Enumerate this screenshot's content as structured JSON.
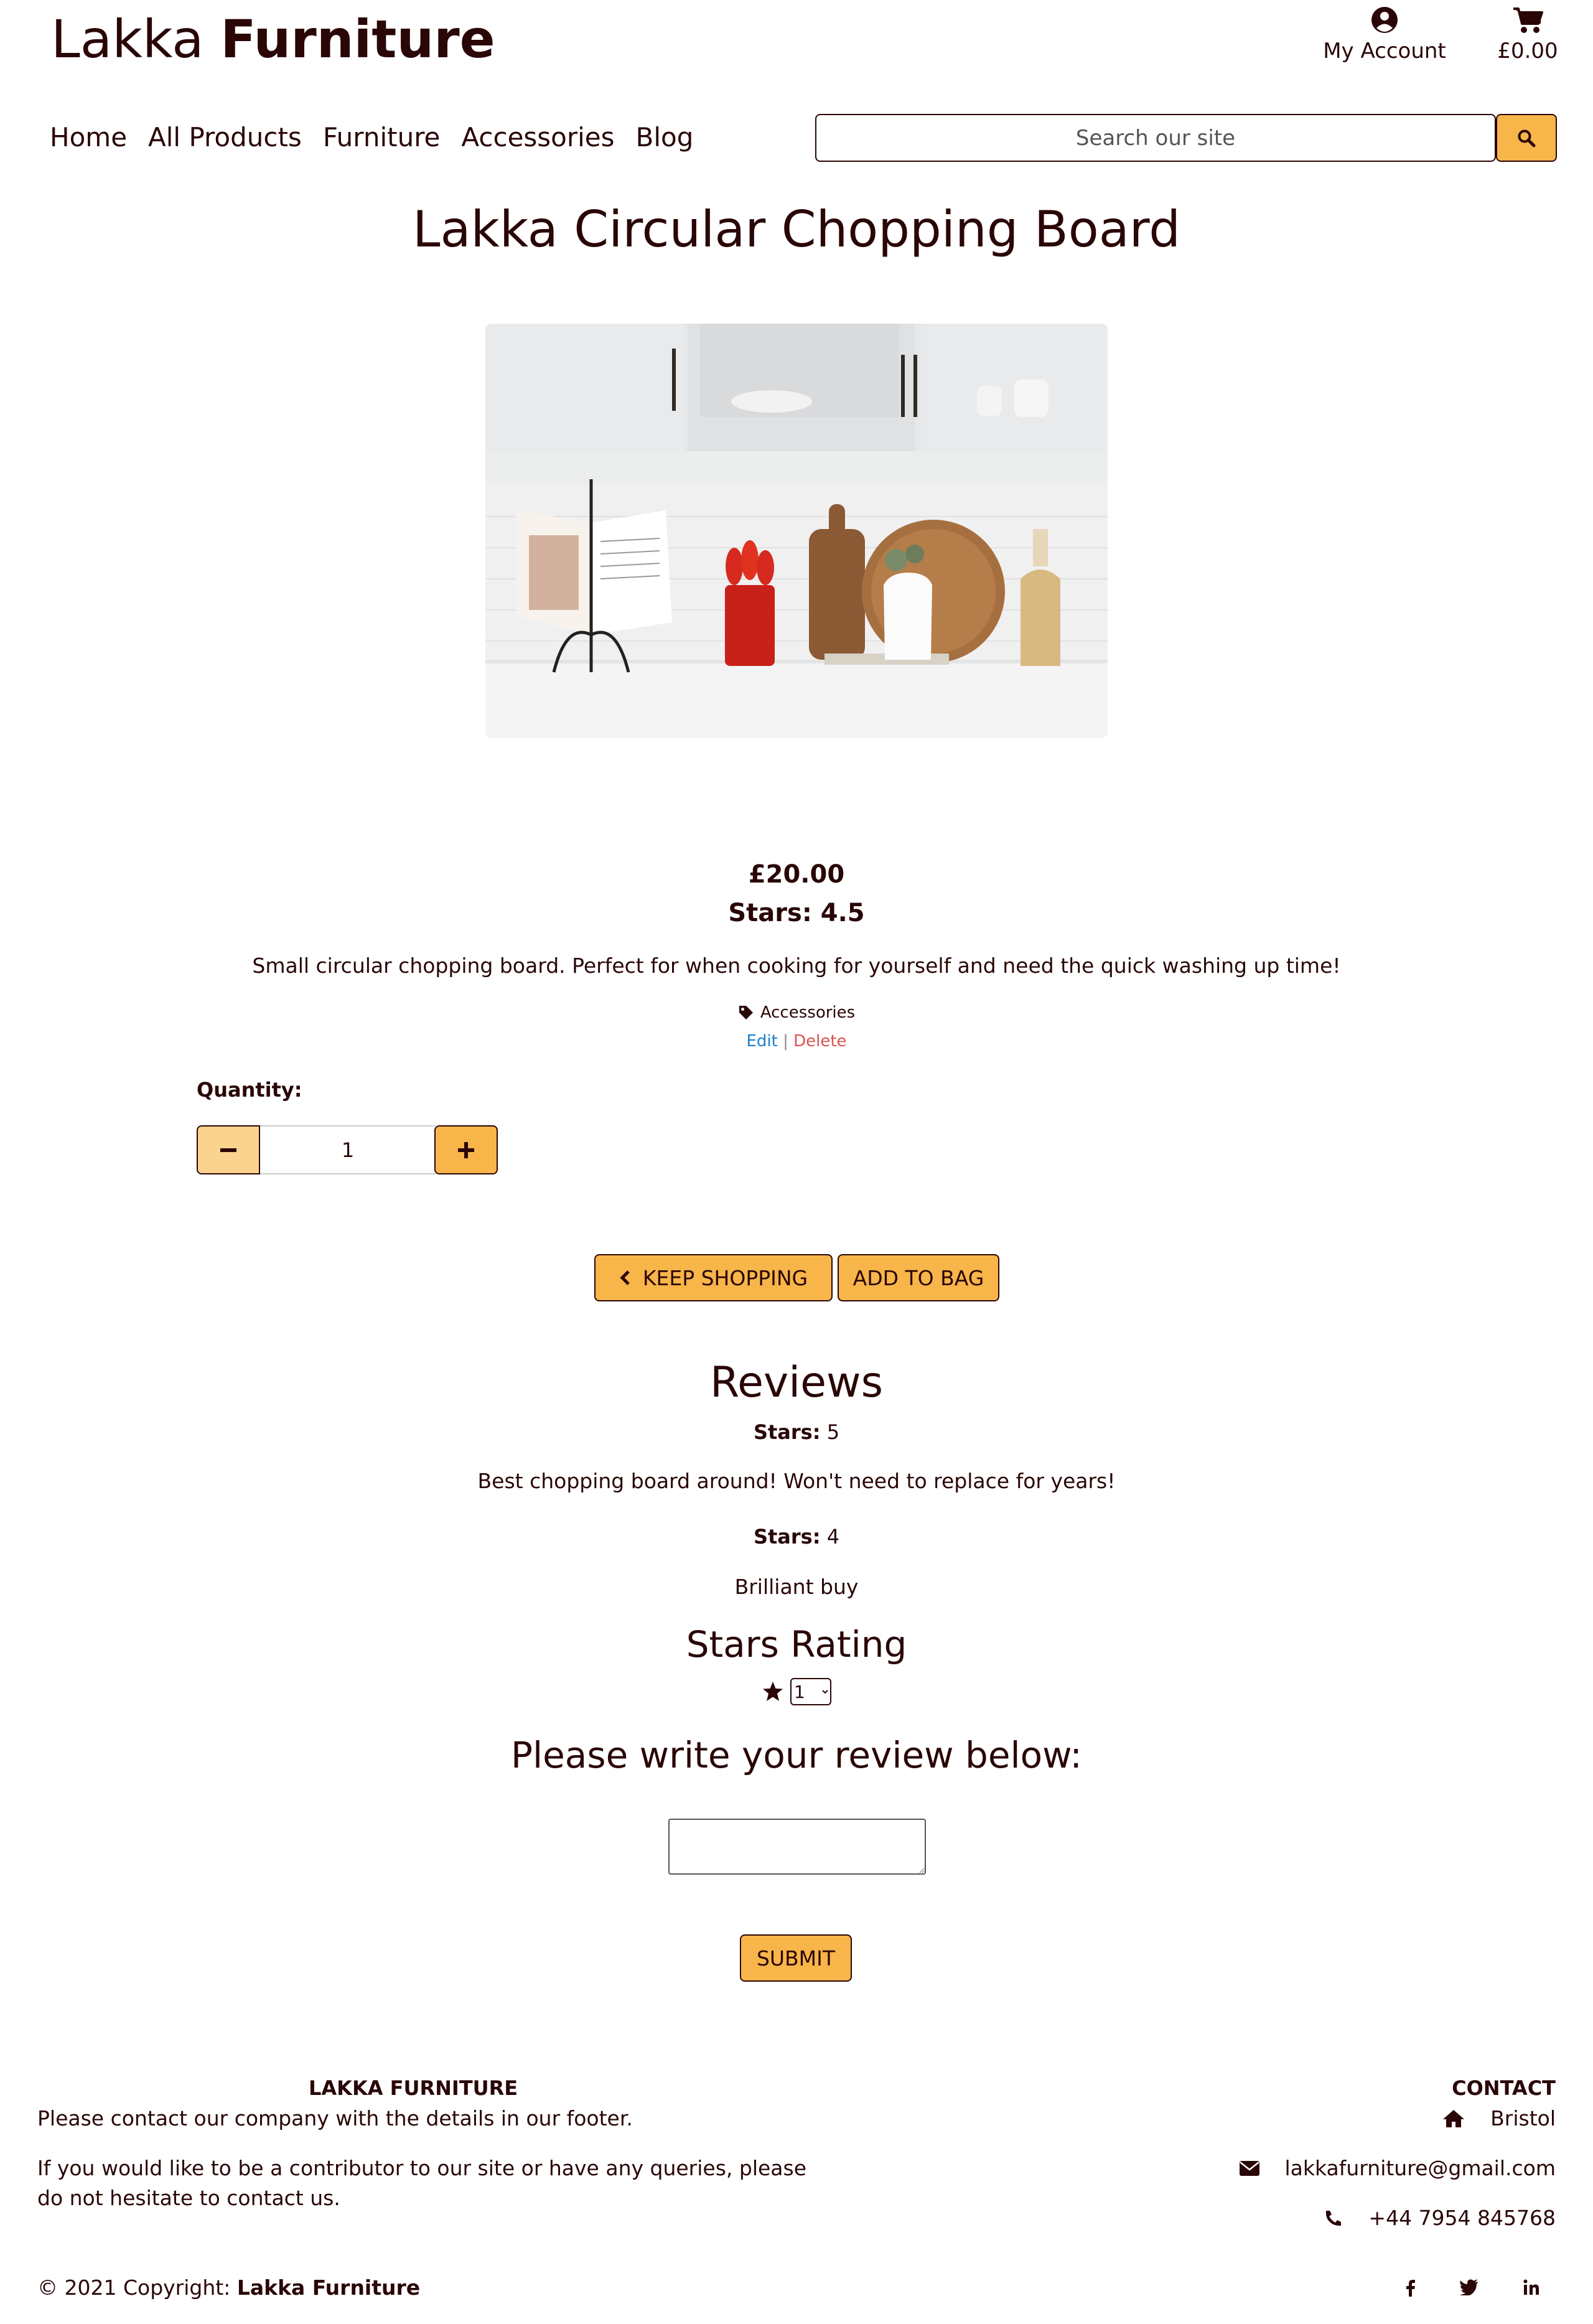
{
  "header": {
    "logo_light": "Lakka ",
    "logo_bold": "Furniture",
    "account_label": "My Account",
    "cart_total": "£0.00"
  },
  "nav": {
    "items": [
      "Home",
      "All Products",
      "Furniture",
      "Accessories",
      "Blog"
    ]
  },
  "search": {
    "placeholder": "Search our site",
    "icon": "search-icon"
  },
  "product": {
    "title": "Lakka Circular Chopping Board",
    "price": "£20.00",
    "stars_text": "Stars: 4.5",
    "description": "Small circular chopping board. Perfect for when cooking for yourself and need the quick washing up time!",
    "category": "Accessories",
    "edit_label": "Edit",
    "separator": "|",
    "delete_label": "Delete"
  },
  "quantity": {
    "label": "Quantity:",
    "value": "1"
  },
  "buttons": {
    "keep_shopping": "KEEP SHOPPING",
    "add_to_bag": "ADD TO BAG",
    "submit": "SUBMIT"
  },
  "reviews": {
    "heading": "Reviews",
    "stars_label": "Stars:",
    "items": [
      {
        "stars": "5",
        "text": "Best chopping board around! Won't need to replace for years!"
      },
      {
        "stars": "4",
        "text": "Brilliant buy"
      }
    ]
  },
  "review_form": {
    "rating_heading": "Stars Rating",
    "rating_selected": "1",
    "write_heading": "Please write your review below:"
  },
  "footer": {
    "about_heading": "LAKKA FURNITURE",
    "about_line1": "Please contact our company with the details in our footer.",
    "about_line2": "If you would like to be a contributor to our site or have any queries, please do not hesitate to contact us.",
    "contact_heading": "CONTACT",
    "location": "Bristol",
    "email": "lakkafurniture@gmail.com",
    "phone": "+44 7954 845768",
    "copyright_prefix": "© 2021 Copyright: ",
    "copyright_brand": "Lakka Furniture"
  },
  "colors": {
    "accent": "#f7b54a",
    "text": "#2a0606",
    "edit_link": "#1a7fd0",
    "delete_link": "#d9534f"
  }
}
